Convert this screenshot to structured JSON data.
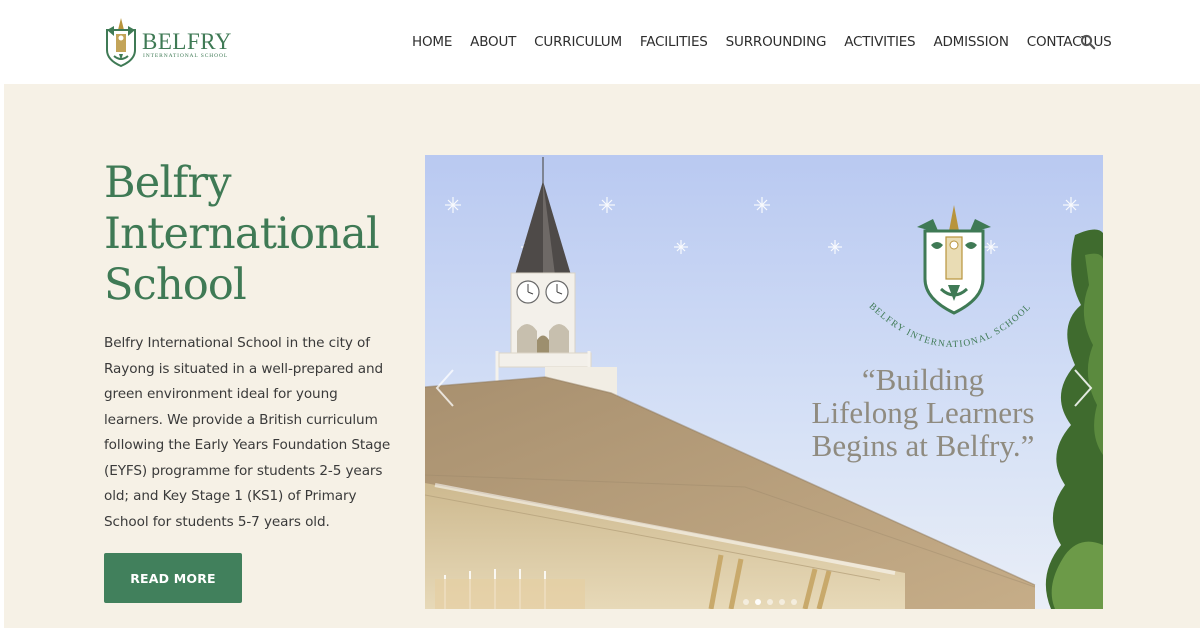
{
  "brand": {
    "name": "BELFRY",
    "subtitle": "INTERNATIONAL SCHOOL",
    "accent_color": "#3f7a55",
    "gold_color": "#b8943c"
  },
  "nav": {
    "items": [
      {
        "label": "HOME"
      },
      {
        "label": "ABOUT"
      },
      {
        "label": "CURRICULUM"
      },
      {
        "label": "FACILITIES"
      },
      {
        "label": "SURROUNDING"
      },
      {
        "label": "ACTIVITIES"
      },
      {
        "label": "ADMISSION"
      },
      {
        "label": "CONTACT US"
      }
    ],
    "search_icon": "search-icon"
  },
  "hero": {
    "title": "Belfry International School",
    "description": "Belfry International School in the city of Rayong is situated in a well-prepared and green environment ideal for young learners. We provide a British curriculum following the Early Years Foundation Stage (EYFS) programme for students 2-5 years old; and Key Stage 1 (KS1) of Primary School for students 5-7 years old.",
    "button_label": "READ MORE",
    "background_color": "#f6f1e6",
    "button_color": "#41805c"
  },
  "slider": {
    "crest_text": "BELFRY INTERNATIONAL SCHOOL",
    "quote_line1": "“Building",
    "quote_line2": "Lifelong Learners",
    "quote_line3": "Begins at Belfry.”",
    "prev_icon": "chevron-left-icon",
    "next_icon": "chevron-right-icon",
    "slide_count": 5,
    "active_slide": 1
  }
}
